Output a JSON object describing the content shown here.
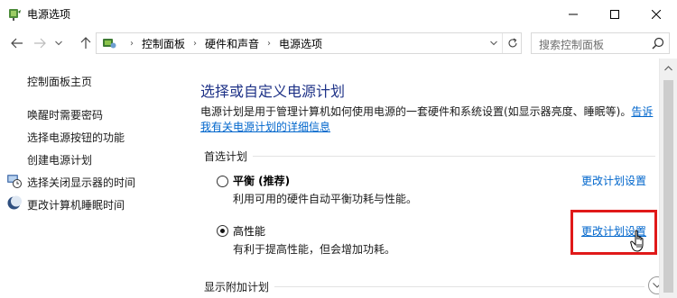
{
  "window": {
    "title": "电源选项",
    "app_icon": "power-options-icon",
    "controls": [
      "minimize-icon",
      "maximize-icon",
      "close-icon"
    ]
  },
  "navigation": {
    "breadcrumb": [
      "控制面板",
      "硬件和声音",
      "电源选项"
    ],
    "search_placeholder": "搜索控制面板"
  },
  "sidebar": {
    "home": "控制面板主页",
    "links": [
      {
        "label": "唤醒时需要密码"
      },
      {
        "label": "选择电源按钮的功能"
      },
      {
        "label": "创建电源计划"
      },
      {
        "label": "选择关闭显示器的时间",
        "icon": "monitor-clock-icon"
      },
      {
        "label": "更改计算机睡眠时间",
        "icon": "moon-icon"
      }
    ]
  },
  "main": {
    "title": "选择或自定义电源计划",
    "description": "电源计划是用于管理计算机如何使用电源的一套硬件和系统设置(如显示器亮度、睡眠等)。",
    "description_link": "告诉我有关电源计划的详细信息",
    "preferred_label": "首选计划",
    "plans": [
      {
        "name": "平衡 (推荐)",
        "desc": "利用可用的硬件自动平衡功耗与性能。",
        "link": "更改计划设置",
        "selected": false
      },
      {
        "name": "高性能",
        "desc": "有利于提高性能，但会增加功耗。",
        "link": "更改计划设置",
        "selected": true
      }
    ],
    "more_plans_label": "显示附加计划"
  },
  "colors": {
    "title_blue": "#1e3287",
    "link_blue": "#0066cc",
    "highlight_red": "#e01919"
  }
}
